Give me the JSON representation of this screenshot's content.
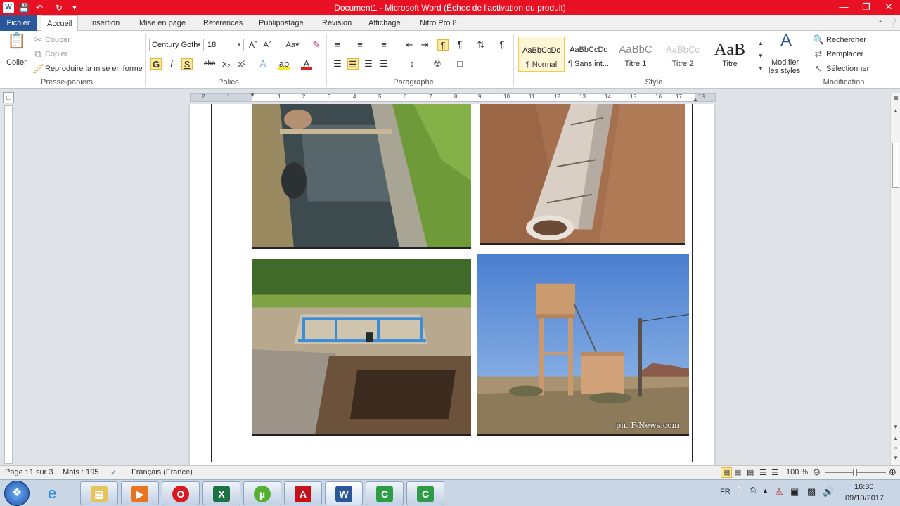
{
  "window": {
    "title": "Document1 - Microsoft Word (Échec de l'activation du produit)",
    "titlebar_color": "#e81123",
    "controls": [
      "minimize-icon",
      "restore-icon",
      "close-icon"
    ]
  },
  "quick_access": [
    "word-logo-icon",
    "save-icon",
    "undo-icon",
    "redo-icon",
    "customize-icon"
  ],
  "tabs": {
    "file": "Fichier",
    "items": [
      "Accueil",
      "Insertion",
      "Mise en page",
      "Références",
      "Publipostage",
      "Révision",
      "Affichage",
      "Nitro Pro 8"
    ],
    "active": "Accueil"
  },
  "ribbon": {
    "clipboard": {
      "paste": "Coller",
      "cut": "Couper",
      "copy": "Copier",
      "format_painter": "Reproduire la mise en forme",
      "label": "Presse-papiers"
    },
    "font": {
      "family": "Century Goth",
      "size": "18",
      "label": "Police",
      "bold": "G",
      "italic": "I",
      "underline": "S"
    },
    "paragraph": {
      "label": "Paragraphe"
    },
    "styles": {
      "label": "Style",
      "items": [
        {
          "preview": "AaBbCcDc",
          "name": "¶ Normal"
        },
        {
          "preview": "AaBbCcDc",
          "name": "¶ Sans int..."
        },
        {
          "preview": "AaBbC",
          "name": "Titre 1"
        },
        {
          "preview": "AaBbCc",
          "name": "Titre 2"
        },
        {
          "preview": "AaB",
          "name": "Titre"
        }
      ],
      "modify_line1": "Modifier",
      "modify_line2": "les styles"
    },
    "editing": {
      "label": "Modification",
      "find": "Rechercher",
      "replace": "Remplacer",
      "select": "Sélectionner"
    }
  },
  "ruler": {
    "numbers": [
      "2",
      "1",
      "1",
      "2",
      "3",
      "4",
      "5",
      "6",
      "7",
      "8",
      "9",
      "10",
      "11",
      "12",
      "13",
      "14",
      "15",
      "16",
      "17",
      "18"
    ]
  },
  "document": {
    "photos": [
      "irrigation canal",
      "concrete pipe in trench",
      "septic drainage field",
      "water tower"
    ],
    "photo_credit": "ph. F-News.com"
  },
  "statusbar": {
    "page": "Page : 1 sur 3",
    "words": "Mots : 195",
    "language": "Français (France)",
    "zoom": "100 %"
  },
  "taskbar": {
    "apps": [
      "Internet Explorer",
      "Explorateur",
      "Media Player",
      "Opera",
      "Excel",
      "uTorrent",
      "Adobe Acrobat",
      "Word",
      "Camtasia",
      "Camtasia Recorder"
    ],
    "lang": "FR",
    "time": "16:30",
    "date": "09/10/2017"
  }
}
